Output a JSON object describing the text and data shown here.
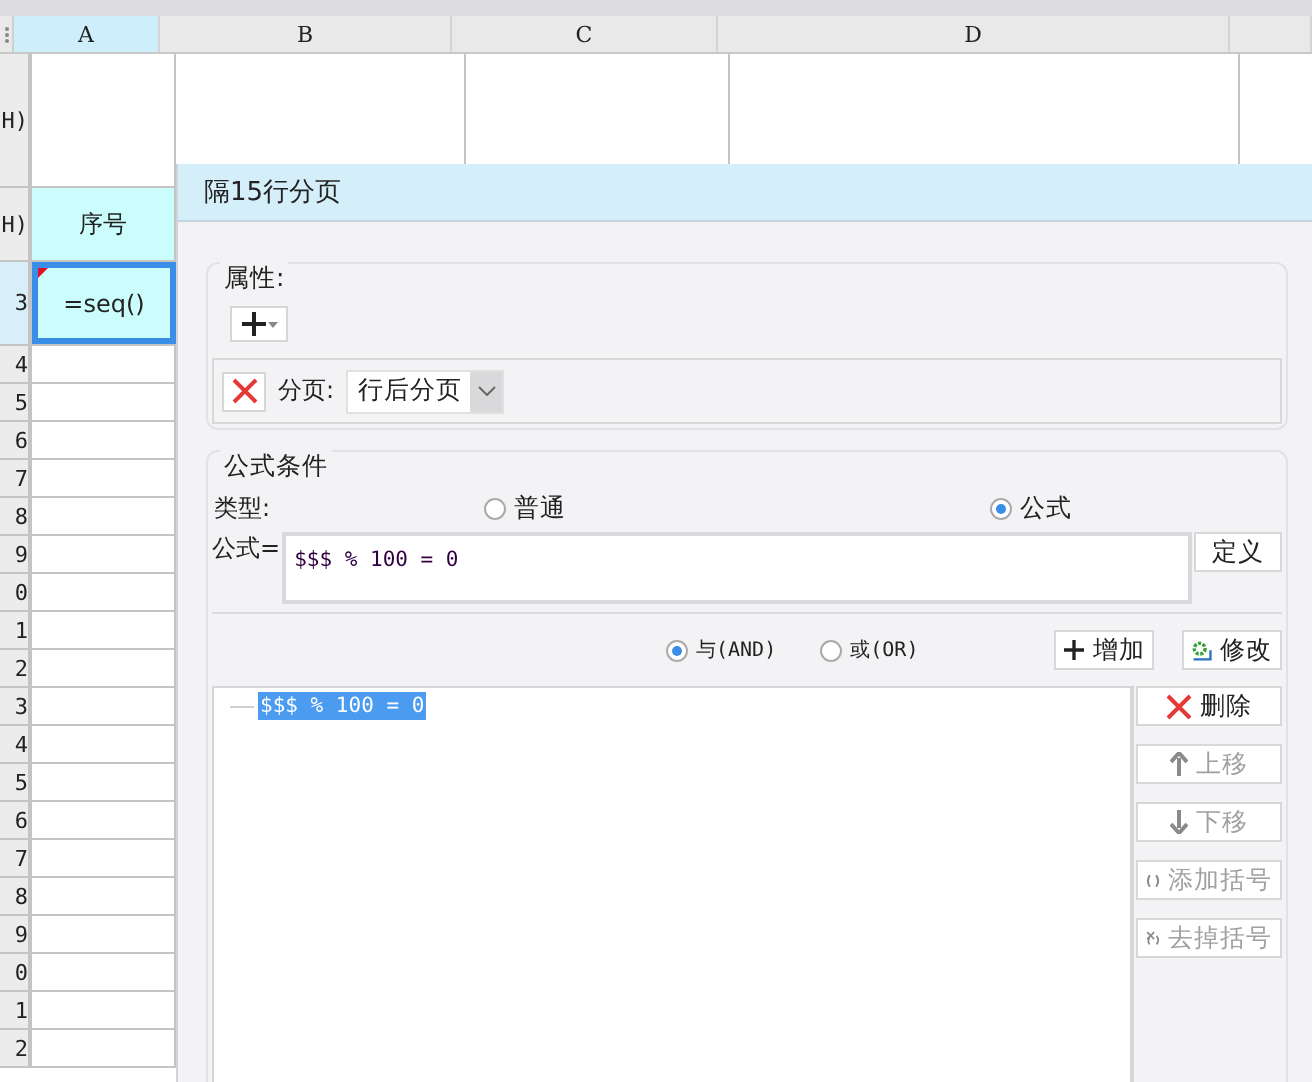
{
  "sheet": {
    "columns": [
      {
        "label": "A",
        "selected": true
      },
      {
        "label": "B",
        "selected": false
      },
      {
        "label": "C",
        "selected": false
      },
      {
        "label": "D",
        "selected": false
      }
    ],
    "rows": [
      {
        "header": "H)",
        "selected": false,
        "cell": null
      },
      {
        "header": "H)",
        "selected": false,
        "cell": {
          "text": "序号",
          "selected": false
        }
      },
      {
        "header": "3",
        "selected": true,
        "cell": {
          "text": "=seq()",
          "selected": true
        }
      },
      {
        "header": "4",
        "selected": false,
        "cell": null
      },
      {
        "header": "5",
        "selected": false,
        "cell": null
      },
      {
        "header": "6",
        "selected": false,
        "cell": null
      },
      {
        "header": "7",
        "selected": false,
        "cell": null
      },
      {
        "header": "8",
        "selected": false,
        "cell": null
      },
      {
        "header": "9",
        "selected": false,
        "cell": null
      },
      {
        "header": "0",
        "selected": false,
        "cell": null
      },
      {
        "header": "1",
        "selected": false,
        "cell": null
      },
      {
        "header": "2",
        "selected": false,
        "cell": null
      },
      {
        "header": "3",
        "selected": false,
        "cell": null
      },
      {
        "header": "4",
        "selected": false,
        "cell": null
      },
      {
        "header": "5",
        "selected": false,
        "cell": null
      },
      {
        "header": "6",
        "selected": false,
        "cell": null
      },
      {
        "header": "7",
        "selected": false,
        "cell": null
      },
      {
        "header": "8",
        "selected": false,
        "cell": null
      },
      {
        "header": "9",
        "selected": false,
        "cell": null
      },
      {
        "header": "0",
        "selected": false,
        "cell": null
      },
      {
        "header": "1",
        "selected": false,
        "cell": null
      },
      {
        "header": "2",
        "selected": false,
        "cell": null
      }
    ]
  },
  "dialog": {
    "title": "隔15行分页",
    "properties": {
      "label": "属性:",
      "page_break_label": "分页:",
      "page_break_value": "行后分页"
    },
    "conditions": {
      "label": "公式条件",
      "type_label": "类型:",
      "type_options": [
        {
          "label": "普通",
          "selected": false
        },
        {
          "label": "公式",
          "selected": true
        }
      ],
      "formula_label": "公式=",
      "formula": "$$$ % 100 = 0",
      "define_button": "定义",
      "logic_options": [
        {
          "label": "与(AND)",
          "selected": true
        },
        {
          "label": "或(OR)",
          "selected": false
        }
      ],
      "add_button": "增加",
      "edit_button": "修改",
      "items": [
        {
          "text": "$$$ % 100 = 0",
          "selected": true
        }
      ],
      "side_buttons": [
        {
          "kind": "delete",
          "label": "删除",
          "disabled": false
        },
        {
          "kind": "up",
          "label": "上移",
          "disabled": true
        },
        {
          "kind": "down",
          "label": "下移",
          "disabled": true
        },
        {
          "kind": "add-paren",
          "label": "添加括号",
          "disabled": true
        },
        {
          "kind": "remove-paren",
          "label": "去掉括号",
          "disabled": true
        }
      ]
    }
  }
}
